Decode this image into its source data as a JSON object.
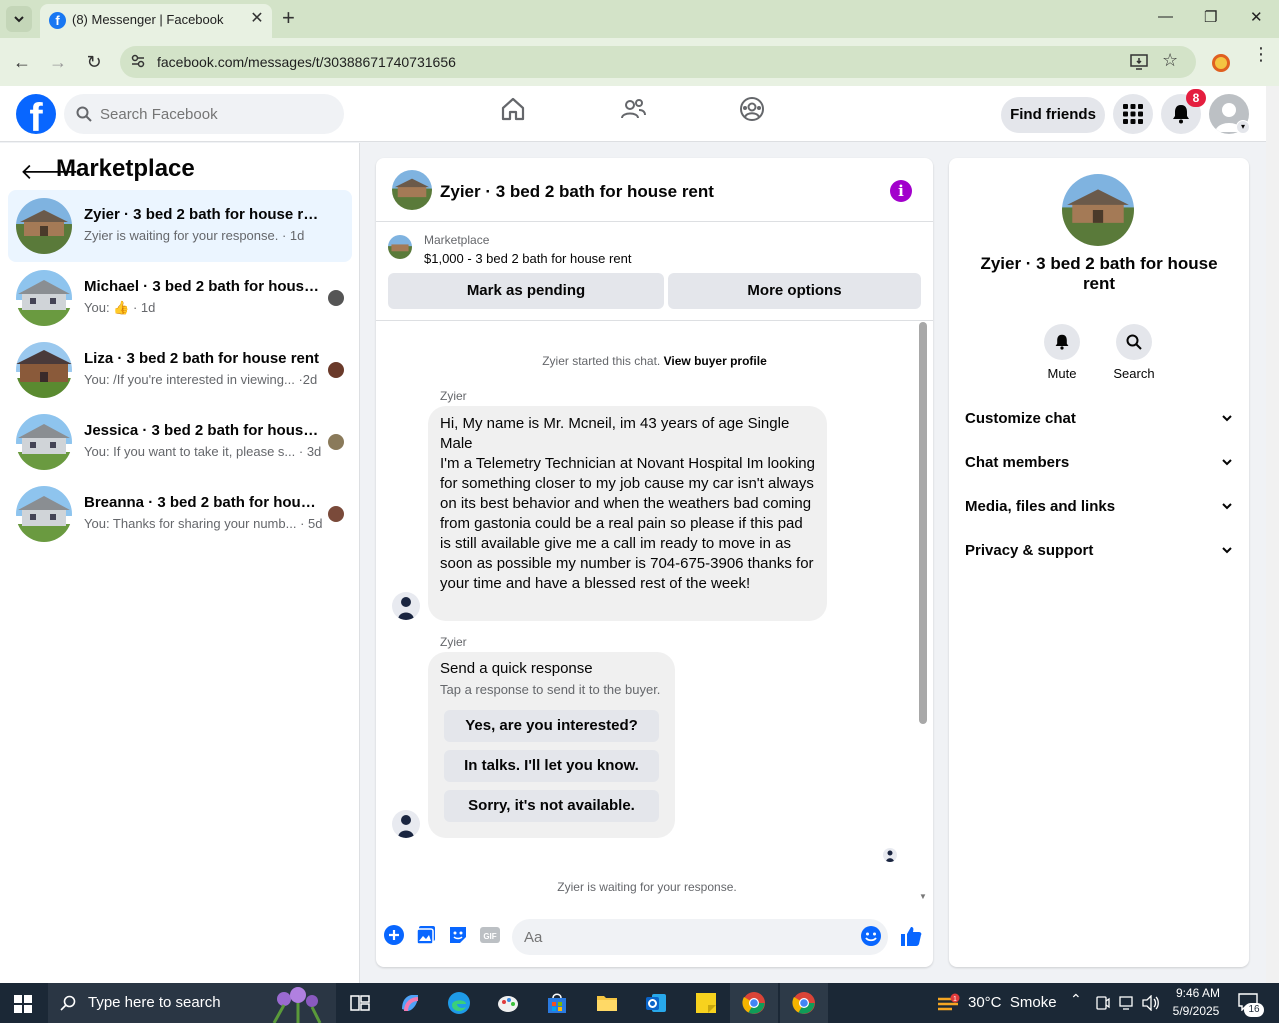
{
  "browser": {
    "tab_title": "(8) Messenger | Facebook",
    "url": "facebook.com/messages/t/30388671740731656"
  },
  "header": {
    "search_placeholder": "Search Facebook",
    "find_friends": "Find friends",
    "notification_count": "8"
  },
  "sidebar": {
    "title": "Marketplace",
    "conversations": [
      {
        "name": "Zyier · 3 bed 2 bath for house rent",
        "preview": "Zyier is waiting for your response.",
        "time": "1d"
      },
      {
        "name": "Michael · 3 bed 2 bath for house rent",
        "preview": "You: ",
        "time": "1d"
      },
      {
        "name": "Liza · 3 bed 2 bath for house rent",
        "preview": "You: /If you're interested in viewing...",
        "time": "2d"
      },
      {
        "name": "Jessica · 3 bed 2 bath for house rent",
        "preview": "You: If you want to take it, please s...",
        "time": "3d"
      },
      {
        "name": "Breanna · 3 bed 2 bath for house rent",
        "preview": "You: Thanks for sharing your numb...",
        "time": "5d"
      }
    ]
  },
  "chat": {
    "title": "Zyier · 3 bed 2 bath for house rent",
    "listing_source": "Marketplace",
    "listing_price": "$1,000 - 3 bed 2 bath for house rent",
    "mark_pending": "Mark as pending",
    "more_options": "More options",
    "started_text": "Zyier started this chat.",
    "view_profile": "View buyer profile",
    "sender": "Zyier",
    "message": "Hi, My name is Mr. Mcneil, im 43 years of age Single Male\nI'm a Telemetry Technician at Novant Hospital Im looking for something closer to my job cause my car isn't always on its best behavior and when the weathers bad coming from gastonia could be a real pain so please if this pad is still available give me a call im ready to move in as soon as possible my number is 704-675-3906 thanks for your time and have a blessed rest of the week!",
    "quick_title": "Send a quick response",
    "quick_sub": "Tap a response to send it to the buyer.",
    "quick_responses": [
      "Yes, are you interested?",
      "In talks. I'll let you know.",
      "Sorry, it's not available."
    ],
    "waiting": "Zyier is waiting for your response.",
    "input_placeholder": "Aa"
  },
  "right_panel": {
    "title": "Zyier · 3 bed 2 bath for house rent",
    "mute": "Mute",
    "search": "Search",
    "sections": [
      "Customize chat",
      "Chat members",
      "Media, files and links",
      "Privacy & support"
    ]
  },
  "taskbar": {
    "search_placeholder": "Type here to search",
    "weather": "30°C  Smoke",
    "weather_badge": "1",
    "time": "9:46 AM",
    "date": "5/9/2025",
    "notifications": "16"
  },
  "colors": {
    "fb_blue": "#0866ff",
    "active_conv": "#ebf5ff",
    "info_purple": "#a200cc"
  }
}
